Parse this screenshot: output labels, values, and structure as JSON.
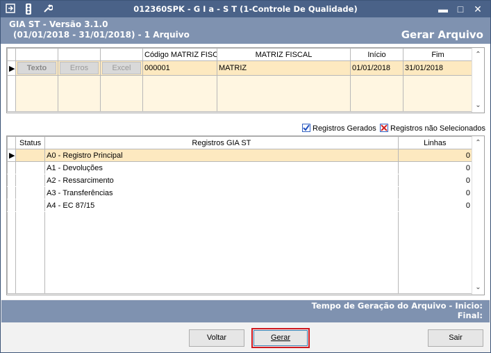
{
  "window": {
    "title": "012360SPK - G I a - S T (1-Controle De Qualidade)",
    "icons": [
      "menu-icon",
      "traffic-light-icon",
      "wrench-icon"
    ],
    "controls": [
      "minimize-icon",
      "maximize-icon",
      "close-icon"
    ]
  },
  "header": {
    "line1": "GIA ST - Versão 3.1.0",
    "line2": "(01/01/2018 - 31/01/2018) - 1 Arquivo",
    "right": "Gerar Arquivo"
  },
  "top_grid": {
    "columns": [
      "",
      "",
      "",
      "Código MATRIZ FISCA",
      "MATRIZ FISCAL",
      "Início",
      "Fim"
    ],
    "row_buttons": [
      "Texto",
      "Erros",
      "Excel"
    ],
    "rows": [
      {
        "codigo": "000001",
        "matriz": "MATRIZ",
        "inicio": "01/01/2018",
        "fim": "31/01/2018"
      }
    ]
  },
  "legend": {
    "gerados": "Registros Gerados",
    "nao_selecionados": "Registros não Selecionados"
  },
  "bottom_grid": {
    "columns": [
      "Status",
      "Registros GIA ST",
      "Linhas"
    ],
    "rows": [
      {
        "registro": "A0 - Registro Principal",
        "linhas": "0"
      },
      {
        "registro": "A1 - Devoluções",
        "linhas": "0"
      },
      {
        "registro": "A2 - Ressarcimento",
        "linhas": "0"
      },
      {
        "registro": "A3 - Transferências",
        "linhas": "0"
      },
      {
        "registro": "A4 - EC 87/15",
        "linhas": "0"
      }
    ]
  },
  "footer": {
    "line1": "Tempo de Geração do Arquivo - Inicio:",
    "line2": "Final:"
  },
  "buttons": {
    "voltar": "Voltar",
    "gerar": "Gerar",
    "sair": "Sair"
  },
  "colors": {
    "titlebar": "#4a6288",
    "header": "#7f92b0",
    "selected_row": "#fde9c0",
    "highlight_border": "#d0181e"
  }
}
